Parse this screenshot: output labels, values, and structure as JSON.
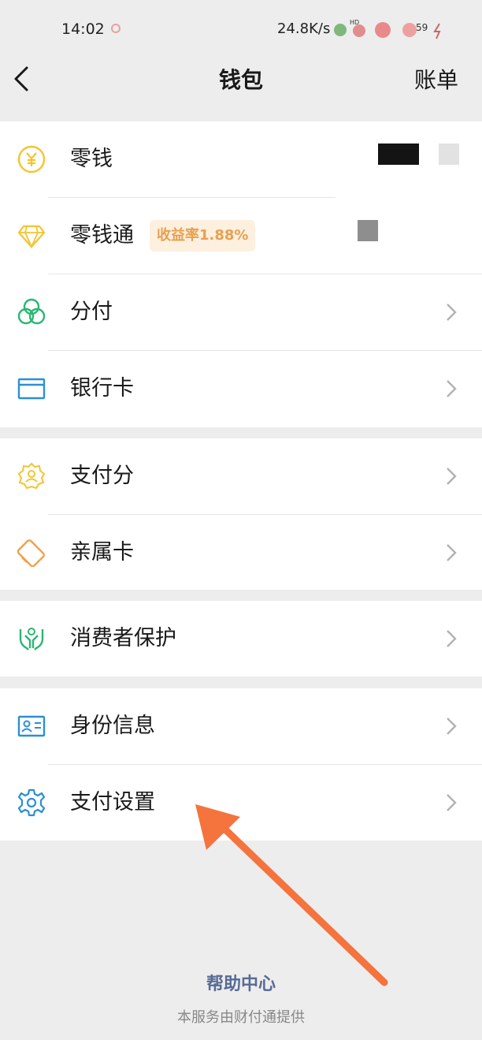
{
  "status_bar": {
    "time": "14:02",
    "net_speed": "24.8K/s",
    "battery": "59"
  },
  "nav": {
    "title": "钱包",
    "right": "账单"
  },
  "groups": [
    {
      "items": [
        {
          "label": "零钱",
          "icon": "coin-icon",
          "color": "#f4c430"
        },
        {
          "label": "零钱通",
          "icon": "diamond-icon",
          "color": "#f4c430",
          "badge": "收益率1.88%"
        },
        {
          "label": "分付",
          "icon": "fenfu-icon",
          "color": "#2bb673"
        },
        {
          "label": "银行卡",
          "icon": "bank-card-icon",
          "color": "#2c8fd6"
        }
      ]
    },
    {
      "items": [
        {
          "label": "支付分",
          "icon": "pay-score-icon",
          "color": "#f4c430"
        },
        {
          "label": "亲属卡",
          "icon": "family-card-icon",
          "color": "#f0a04a"
        }
      ]
    },
    {
      "items": [
        {
          "label": "消费者保护",
          "icon": "consumer-protection-icon",
          "color": "#2bb673"
        }
      ]
    },
    {
      "items": [
        {
          "label": "身份信息",
          "icon": "id-card-icon",
          "color": "#2c8fd6"
        },
        {
          "label": "支付设置",
          "icon": "gear-icon",
          "color": "#2c8fd6"
        }
      ]
    }
  ],
  "footer": {
    "help": "帮助中心",
    "provider": "本服务由财付通提供"
  },
  "annotation": {
    "arrow_color": "#f5733d"
  }
}
